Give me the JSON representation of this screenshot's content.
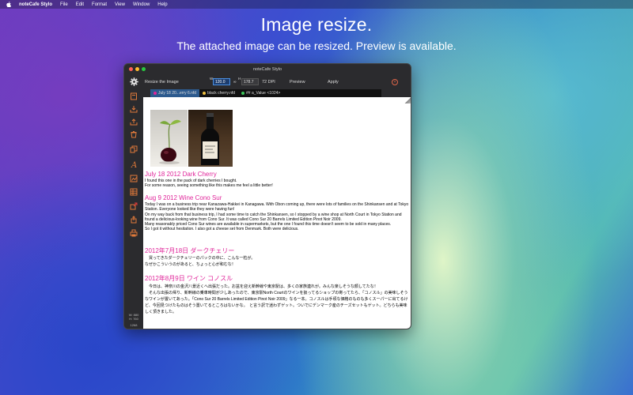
{
  "menubar": {
    "app_name": "noteCafe Stylo",
    "items": [
      "File",
      "Edit",
      "Format",
      "View",
      "Window",
      "Help"
    ]
  },
  "headline": "Image resize.",
  "subline": "The attached image can be resized. Preview is available.",
  "window": {
    "title": "noteCafe Stylo",
    "resize": {
      "label": "Resize the Image",
      "w_label": "W",
      "w_value": "120.0",
      "link_symbol": "∞",
      "h_label": "H",
      "h_value": "178.7",
      "dpi": "72 DPI",
      "preview_label": "Preview",
      "apply_label": "Apply"
    },
    "tabs": [
      {
        "label": "July 18 20...erry 6.nfd",
        "color": "#e0259a"
      },
      {
        "label": "black cherry.nfd",
        "color": "#f0c040"
      },
      {
        "label": "## a_Value  <1024>",
        "color": "#3cc85a"
      }
    ],
    "status": {
      "w": "W: 880",
      "h": "H: 760",
      "size": "1268"
    }
  },
  "colors": {
    "heading": "#e0259a",
    "accent": "#4a90e2"
  },
  "document": {
    "entries": [
      {
        "heading": "July 18 2012   Dark Cherry",
        "body": " I found this one in the pack of dark cherries I bought.\nFor some reason, seeing something like this makes me feel a little better!"
      },
      {
        "heading": "Aug 9 2012   Wine Cono Sur",
        "body": " Today I was on a business trip near Kanazawa-Hakkei in Kanagawa. With Obon coming up, there were lots of families on the Shinkansen and at Tokyo Station. Everyone looked like they were having fun!\n On my way back from that business trip, I had some time to catch the Shinkansen, so I stopped by a wine shop at North Court in Tokyo Station and found a delicious-looking wine from Cono Sur. It was called Cono Sur 20 Barrels Limited Edition Pinot Noir 2009.\nMany reasonably priced Cono Sur wines are available in supermarkets, but the one I found this time doesn't seem to be sold in many places.\nSo I got it without hesitation. I also got a cheese set from Denmark. Both were delicious."
      },
      {
        "heading": "2012年7月18日   ダークチェリー",
        "body": "　買ってきたダークチェリーのパックの中に、こんな一粒が。\nなぜかこういうのがあると、ちょっと心が和むな！"
      },
      {
        "heading": "2012年8月9日   ワイン コノスル",
        "body": "　今日は、神奈川の金沢八景近くへ出張だった。お盆を迎え新幹線や東京駅は、多くの家族連れが。みんな楽しそうな顔してたな！\n　そんな出張の帰り、新幹線の乗車時間が少しあったので、東京駅North Courtのワインを扱ってるショップの寄ってたら、「コノスル」の美味しそうなワインが置いてあった。「Cono Sur 20 Barrels Limited Edition Pinot Noir 2009」なる一本。コノスルは手頃な価格のものも多くスーパーに出てるけど、今回見つけたものはそう置いてるところはないかな。　と言う訳で迷わずゲット。ついでにデンマーク産のチーズセットもゲット。どちらも美味しく頂きました。"
      }
    ]
  }
}
